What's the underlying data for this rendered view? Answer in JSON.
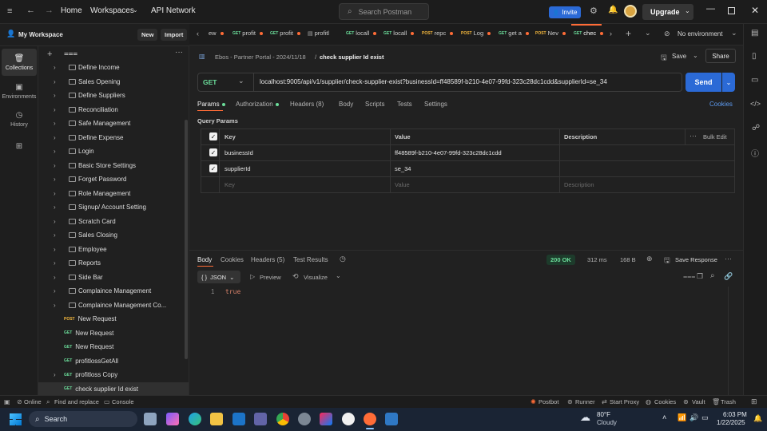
{
  "header": {
    "nav": [
      "Home",
      "Workspaces",
      "API Network"
    ],
    "search_placeholder": "Search Postman",
    "invite_label": "Invite",
    "upgrade_label": "Upgrade"
  },
  "workspace": {
    "name": "My Workspace",
    "new_label": "New",
    "import_label": "Import"
  },
  "rail": [
    "Collections",
    "Environments",
    "History"
  ],
  "sidebar": {
    "folders": [
      "Define Income",
      "Sales Opening",
      "Define Suppliers",
      "Reconciliation",
      "Safe Management",
      "Define Expense",
      "Login",
      "Basic Store Settings",
      "Forget Password",
      "Role Management",
      "Signup/ Account Setting",
      "Scratch Card",
      "Sales Closing",
      "Employee",
      "Reports",
      "Side Bar",
      "Complaince Management",
      "Complaince Management Co..."
    ],
    "requests": [
      {
        "method": "POST",
        "name": "New Request"
      },
      {
        "method": "GET",
        "name": "New Request"
      },
      {
        "method": "GET",
        "name": "New Request"
      },
      {
        "method": "GET",
        "name": "profitlossGetAll"
      },
      {
        "method": "GET",
        "name": "profitloss Copy",
        "folder": true
      },
      {
        "method": "GET",
        "name": "check supplier Id exist"
      }
    ]
  },
  "tabs": [
    {
      "method": "",
      "label": "ew"
    },
    {
      "method": "GET",
      "label": "profit"
    },
    {
      "method": "GET",
      "label": "profit"
    },
    {
      "method": "",
      "label": "profitl"
    },
    {
      "method": "GET",
      "label": "locall"
    },
    {
      "method": "GET",
      "label": "locall"
    },
    {
      "method": "POST",
      "label": "repc"
    },
    {
      "method": "POST",
      "label": "Log"
    },
    {
      "method": "GET",
      "label": "get a"
    },
    {
      "method": "POST",
      "label": "Nev"
    },
    {
      "method": "GET",
      "label": "chec"
    }
  ],
  "environment": "No environment",
  "breadcrumb": {
    "collection": "Ebos - Partner Portal - 2024/11/18",
    "separator": "/",
    "request": "check supplier Id exist"
  },
  "actions": {
    "save": "Save",
    "share": "Share"
  },
  "request": {
    "method": "GET",
    "url": "localhost:9005/api/v1/supplier/check-supplier-exist?businessId=ff48589f-b210-4e07-99fd-323c28dc1cdd&supplierId=se_34",
    "send": "Send"
  },
  "request_tabs": [
    "Params",
    "Authorization",
    "Headers (8)",
    "Body",
    "Scripts",
    "Tests",
    "Settings"
  ],
  "cookies_label": "Cookies",
  "query_params": {
    "title": "Query Params",
    "headers": [
      "Key",
      "Value",
      "Description"
    ],
    "bulk_edit": "Bulk Edit",
    "rows": [
      {
        "key": "businessId",
        "value": "ff48589f-b210-4e07-99fd-323c28dc1cdd"
      },
      {
        "key": "supplierId",
        "value": "se_34"
      }
    ],
    "placeholder": {
      "key": "Key",
      "value": "Value",
      "description": "Description"
    }
  },
  "response": {
    "tabs": [
      "Body",
      "Cookies",
      "Headers (5)",
      "Test Results"
    ],
    "status": "200 OK",
    "time": "312 ms",
    "size": "168 B",
    "save_response": "Save Response",
    "format": "JSON",
    "preview": "Preview",
    "visualize": "Visualize",
    "line_number": "1",
    "body": "true"
  },
  "statusbar": {
    "left": [
      "Online",
      "Find and replace",
      "Console"
    ],
    "right": [
      "Postbot",
      "Runner",
      "Start Proxy",
      "Cookies",
      "Vault",
      "Trash"
    ]
  },
  "taskbar": {
    "search": "Search",
    "weather_temp": "80°F",
    "weather_desc": "Cloudy",
    "time": "6:03 PM",
    "date": "1/22/2025"
  },
  "colors": {
    "accent": "#2b6ad6",
    "brand": "#ff6c37",
    "get": "#6bdd9a",
    "post": "#f5b83d"
  }
}
